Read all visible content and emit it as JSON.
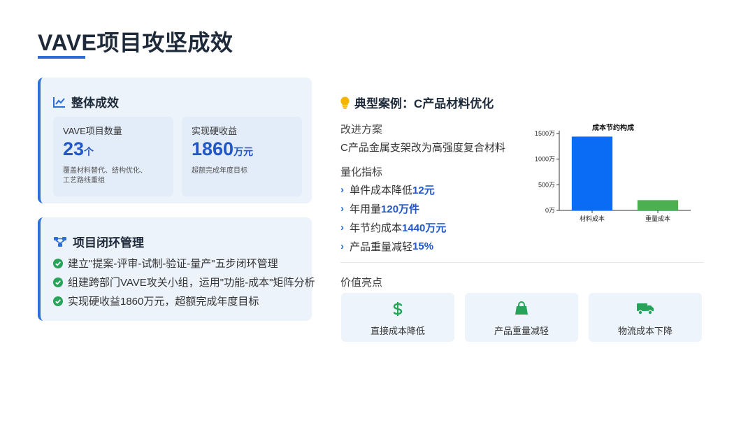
{
  "page": {
    "title": "VAVE项目攻坚成效"
  },
  "overall": {
    "heading": "整体成效",
    "metrics": [
      {
        "label": "VAVE项目数量",
        "value": "23",
        "unit": "个",
        "desc": "覆盖材料替代、结构优化、\n工艺路线重组"
      },
      {
        "label": "实现硬收益",
        "value": "1860",
        "unit": "万元",
        "desc": "超额完成年度目标"
      }
    ]
  },
  "loop": {
    "heading": "项目闭环管理",
    "items": [
      "建立\"提案-评审-试制-验证-量产\"五步闭环管理",
      "组建跨部门VAVE攻关小组，运用\"功能-成本\"矩阵分析",
      "实现硬收益1860万元，超额完成年度目标"
    ]
  },
  "case": {
    "heading": "典型案例：C产品材料优化",
    "plan_label": "改进方案",
    "plan_text": "C产品金属支架改为高强度复合材料",
    "metrics_label": "量化指标",
    "metrics": [
      {
        "text": "单件成本降低",
        "highlight": "12元"
      },
      {
        "text": "年用量",
        "highlight": "120万件"
      },
      {
        "text": "年节约成本",
        "highlight": "1440万元"
      },
      {
        "text": "产品重量减轻",
        "highlight": "15%"
      }
    ],
    "value_label": "价值亮点",
    "values": [
      {
        "label": "直接成本降低",
        "icon": "dollar-icon"
      },
      {
        "label": "产品重量减轻",
        "icon": "shopping-bag-icon"
      },
      {
        "label": "物流成本下降",
        "icon": "truck-icon"
      }
    ]
  },
  "colors": {
    "accent": "#2d6fd6",
    "highlight": "#2157c8",
    "check": "#27a35a",
    "bar_primary": "#0a6cf5",
    "bar_secondary": "#4caf50",
    "value_icon": "#27a35a"
  },
  "chart_data": {
    "type": "bar",
    "title": "成本节约构成",
    "categories": [
      "材料成本",
      "重量成本"
    ],
    "values": [
      1440,
      200
    ],
    "ylim": [
      0,
      1500
    ],
    "yticks": [
      0,
      500,
      1000,
      1500
    ],
    "ytick_labels": [
      "0万",
      "500万",
      "1000万",
      "1500万"
    ],
    "grid": false,
    "legend": "none"
  }
}
